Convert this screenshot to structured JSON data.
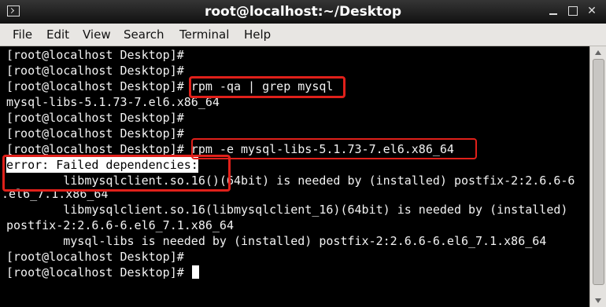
{
  "window": {
    "title": "root@localhost:~/Desktop"
  },
  "menu": [
    "File",
    "Edit",
    "View",
    "Search",
    "Terminal",
    "Help"
  ],
  "terminal": {
    "lines": [
      "[root@localhost Desktop]#",
      "[root@localhost Desktop]#",
      "[root@localhost Desktop]# rpm -qa | grep mysql",
      "mysql-libs-5.1.73-7.el6.x86_64",
      "[root@localhost Desktop]#",
      "[root@localhost Desktop]#",
      "[root@localhost Desktop]# rpm -e mysql-libs-5.1.73-7.el6.x86_64",
      "error: Failed dependencies:",
      "        libmysqlclient.so.16()(64bit) is needed by (installed) postfix-2:2.6.6-6",
      ".el6_7.1.x86_64",
      "        libmysqlclient.so.16(libmysqlclient_16)(64bit) is needed by (installed)",
      "postfix-2:2.6.6-6.el6_7.1.x86_64",
      "        mysql-libs is needed by (installed) postfix-2:2.6.6-6.el6_7.1.x86_64",
      "[root@localhost Desktop]#",
      "[root@localhost Desktop]#"
    ]
  },
  "colors": {
    "annotation": "#e0201a",
    "terminal_bg": "#000000",
    "terminal_fg": "#f2f2f2"
  }
}
